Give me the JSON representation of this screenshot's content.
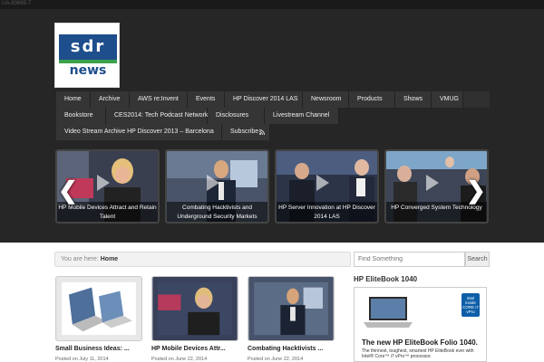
{
  "topbar": {
    "ua_text": "UA-83665-7"
  },
  "logo": {
    "line1": "sdr",
    "line2": "news"
  },
  "nav": {
    "row1": [
      "Home",
      "Archive",
      "AWS re:Invent",
      "Events",
      "HP Discover 2014 LAS",
      "Newsroom",
      "Products",
      "Shows",
      "VMUG"
    ],
    "row2": [
      "Bookstore",
      "CES2014: Tech Podcast Network",
      "Disclosures",
      "Livestream Channel"
    ],
    "row3": [
      "Video Stream Archive HP Discover 2013 – Barcelona",
      "Subscribe"
    ]
  },
  "featured": [
    {
      "caption": "HP Mobile Devices Attract and Retain Talent"
    },
    {
      "caption": "Combating Hacktivists and Underground Security Markets"
    },
    {
      "caption": "HP Server Innovation at HP Discover 2014 LAS"
    },
    {
      "caption": "HP Converged System Technology"
    }
  ],
  "slider": {
    "prev": "❮",
    "next": "❯"
  },
  "breadcrumb": {
    "prefix": "You are here:",
    "current": "Home"
  },
  "search": {
    "placeholder": "Find Something",
    "button": "Search"
  },
  "posts": [
    {
      "title": "Small Business Ideas: ...",
      "date": "Posted on July 11, 2014"
    },
    {
      "title": "HP Mobile Devices Attr...",
      "date": "Posted on June 22, 2014"
    },
    {
      "title": "Combating Hacktivists ...",
      "date": "Posted on June 22, 2014"
    }
  ],
  "sidebar": {
    "title": "HP EliteBook 1040",
    "ad_headline": "The new HP EliteBook Folio 1040.",
    "ad_sub": "The thinnest, toughest, smartest HP EliteBook ever with Intel® Core™ i7 vPro™ processor.",
    "intel_label": "intel inside CORE i7 vPro"
  },
  "colors": {
    "header_bg": "#262626",
    "nav_bg": "#353535",
    "logo_blue": "#1e4e8c",
    "logo_green": "#3ba24a"
  }
}
